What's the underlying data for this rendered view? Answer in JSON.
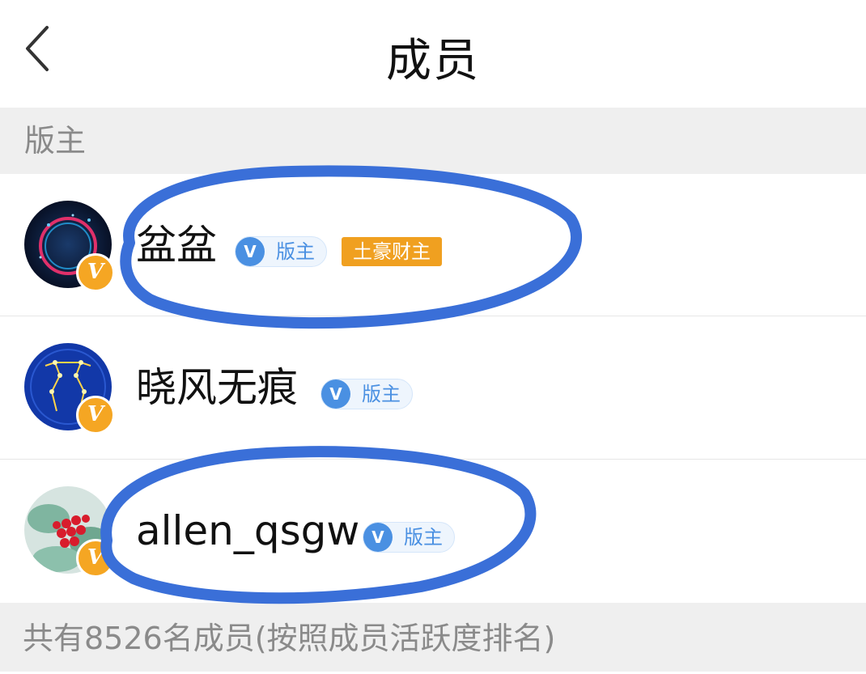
{
  "header": {
    "title": "成员"
  },
  "sections": {
    "moderators_label": "版主",
    "footer_text": "共有8526名成员(按照成员活跃度排名)"
  },
  "members": [
    {
      "name": "盆盆",
      "role_badge": "版主",
      "extra_badge": "土豪财主",
      "verified_badge": "V"
    },
    {
      "name": "晓风无痕",
      "role_badge": "版主",
      "verified_badge": "V"
    },
    {
      "name": "allen_qsgw",
      "role_badge": "版主",
      "verified_badge": "V"
    }
  ],
  "badge_icons": {
    "role_icon_text": "V",
    "verified_icon_text": "V"
  },
  "colors": {
    "accent_blue": "#4a90e2",
    "gold": "#f0a020",
    "annotation_blue": "#3a6fd8",
    "section_bg": "#efefef"
  }
}
